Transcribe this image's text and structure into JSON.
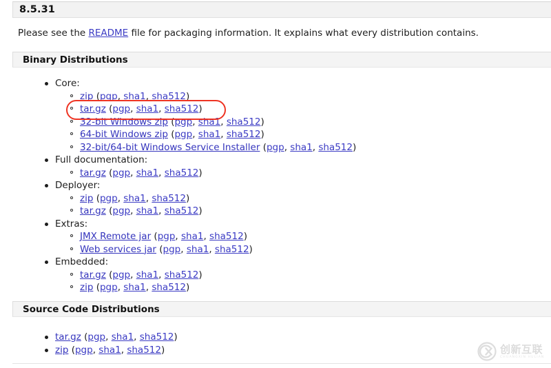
{
  "page": {
    "version": "8.5.31",
    "intro": {
      "before": "Please see the ",
      "link": "README",
      "after": " file for packaging information. It explains what every distribution contains."
    }
  },
  "sections": {
    "binary": {
      "heading": "Binary Distributions",
      "groups": [
        {
          "label": "Core:",
          "items": [
            {
              "name": "zip",
              "hashes": [
                "pgp",
                "sha1",
                "sha512"
              ]
            },
            {
              "name": "tar.gz",
              "hashes": [
                "pgp",
                "sha1",
                "sha512"
              ],
              "highlighted": true
            },
            {
              "name": "32-bit Windows zip",
              "hashes": [
                "pgp",
                "sha1",
                "sha512"
              ]
            },
            {
              "name": "64-bit Windows zip",
              "hashes": [
                "pgp",
                "sha1",
                "sha512"
              ]
            },
            {
              "name": "32-bit/64-bit Windows Service Installer",
              "hashes": [
                "pgp",
                "sha1",
                "sha512"
              ]
            }
          ]
        },
        {
          "label": "Full documentation:",
          "items": [
            {
              "name": "tar.gz",
              "hashes": [
                "pgp",
                "sha1",
                "sha512"
              ]
            }
          ]
        },
        {
          "label": "Deployer:",
          "items": [
            {
              "name": "zip",
              "hashes": [
                "pgp",
                "sha1",
                "sha512"
              ]
            },
            {
              "name": "tar.gz",
              "hashes": [
                "pgp",
                "sha1",
                "sha512"
              ]
            }
          ]
        },
        {
          "label": "Extras:",
          "items": [
            {
              "name": "JMX Remote jar",
              "hashes": [
                "pgp",
                "sha1",
                "sha512"
              ]
            },
            {
              "name": "Web services jar",
              "hashes": [
                "pgp",
                "sha1",
                "sha512"
              ]
            }
          ]
        },
        {
          "label": "Embedded:",
          "items": [
            {
              "name": "tar.gz",
              "hashes": [
                "pgp",
                "sha1",
                "sha512"
              ]
            },
            {
              "name": "zip",
              "hashes": [
                "pgp",
                "sha1",
                "sha512"
              ]
            }
          ]
        }
      ]
    },
    "source": {
      "heading": "Source Code Distributions",
      "items": [
        {
          "name": "tar.gz",
          "hashes": [
            "pgp",
            "sha1",
            "sha512"
          ]
        },
        {
          "name": "zip",
          "hashes": [
            "pgp",
            "sha1",
            "sha512"
          ]
        }
      ]
    }
  },
  "annotation": {
    "shape": "rounded-rectangle",
    "color": "#ee3322",
    "targets": "Core > tar.gz (pgp, sha1, sha512)"
  },
  "watermark": {
    "logo": "cx-circle-logo",
    "chinese": "创新互联",
    "subtitle": "CHUANGXIN HULIAN"
  },
  "colors": {
    "link": "#3b3bc4",
    "text": "#1d1d1d",
    "heading_bar_bg": "#f2f2f2",
    "annotation": "#ee3322"
  }
}
